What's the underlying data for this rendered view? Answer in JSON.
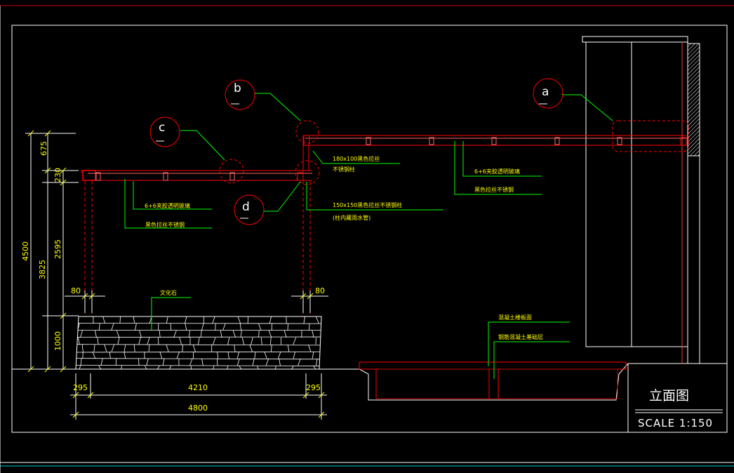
{
  "drawing": {
    "title": "立面图",
    "scale": "SCALE 1:150",
    "colors": {
      "background": "#000000",
      "frame": "#ffffff",
      "structure": "#ff0000",
      "leader": "#00ff00",
      "dimension": "#ffff00",
      "stone": "#ffffff"
    }
  },
  "detail_markers": [
    {
      "id": "a",
      "label": "a"
    },
    {
      "id": "b",
      "label": "b"
    },
    {
      "id": "c",
      "label": "c"
    },
    {
      "id": "d",
      "label": "d"
    }
  ],
  "annotations": {
    "glass_left": "6+6夹胶透明玻璃",
    "steel_left": "黑色拉丝不锈钢",
    "beam_mid_line1": "180x100黑色拉丝",
    "beam_mid_line2": "不锈钢柱",
    "glass_right": "6+6夹胶透明玻璃",
    "steel_right": "黑色拉丝不锈钢",
    "column_line1": "150x150黑色拉丝不锈钢柱",
    "column_line2": "(柱内藏雨水管)",
    "stone": "文化石",
    "slab1": "混凝土楼板面",
    "slab2": "钢筋混凝土基础层"
  },
  "dimensions": {
    "vertical": [
      "675",
      "230",
      "2595",
      "1000",
      "3825",
      "4500"
    ],
    "post_left": "80",
    "post_right": "80",
    "bottom_left": "295",
    "bottom_mid": "4210",
    "bottom_right": "295",
    "bottom_total": "4800"
  }
}
